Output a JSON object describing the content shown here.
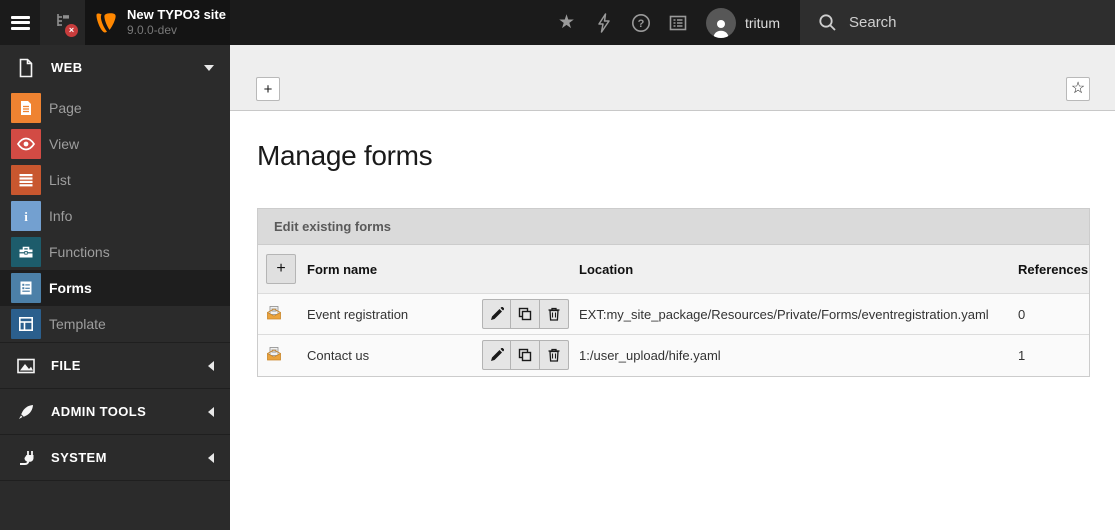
{
  "colors": {
    "brand_orange": "#FF8700",
    "topbar_bg": "#1b1b1b",
    "sidebar_bg": "#2b2b2b",
    "module_page": "#EF8331",
    "module_view": "#D24B44",
    "module_list": "#C8572F",
    "module_info": "#73A0D0",
    "module_functions": "#1D5C6B",
    "module_forms": "#4C80A8",
    "module_template": "#2B5F8D",
    "badge_red": "#c83c3c"
  },
  "topbar": {
    "site_title": "New TYPO3 site",
    "site_version": "9.0.0-dev",
    "username": "tritum",
    "search_placeholder": "Search",
    "icons": [
      "hamburger-icon",
      "pagetree-toggle-icon",
      "bookmark-star-icon",
      "flush-cache-bolt-icon",
      "help-icon",
      "systeminfo-list-icon",
      "magnifier-icon"
    ]
  },
  "sidebar": {
    "sections": [
      {
        "label": "WEB",
        "expanded": true,
        "items": [
          {
            "label": "Page"
          },
          {
            "label": "View"
          },
          {
            "label": "List"
          },
          {
            "label": "Info"
          },
          {
            "label": "Functions"
          },
          {
            "label": "Forms",
            "active": true
          },
          {
            "label": "Template"
          }
        ]
      },
      {
        "label": "FILE",
        "expanded": false
      },
      {
        "label": "ADMIN TOOLS",
        "expanded": false
      },
      {
        "label": "SYSTEM",
        "expanded": false
      }
    ]
  },
  "docheader": {
    "new_form_label": "+",
    "bookmark_label": "☆"
  },
  "content": {
    "title": "Manage forms",
    "panel": {
      "heading": "Edit existing forms",
      "add_label": "+",
      "columns": {
        "form_name": "Form name",
        "location": "Location",
        "references": "References"
      },
      "row_actions": [
        "edit",
        "duplicate",
        "delete"
      ],
      "rows": [
        {
          "name": "Event registration",
          "location": "EXT:my_site_package/Resources/Private/Forms/eventregistration.yaml",
          "references": "0"
        },
        {
          "name": "Contact us",
          "location": "1:/user_upload/hife.yaml",
          "references": "1"
        }
      ]
    }
  }
}
